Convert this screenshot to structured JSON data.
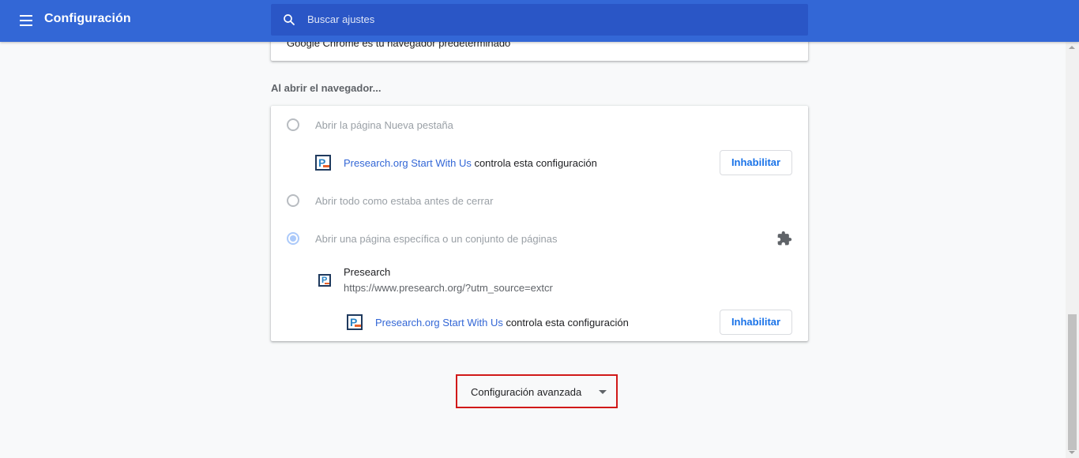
{
  "header": {
    "title": "Configuración",
    "search_placeholder": "Buscar ajustes"
  },
  "default_browser": {
    "text": "Google Chrome es tu navegador predeterminado"
  },
  "on_startup": {
    "section_title": "Al abrir el navegador...",
    "options": [
      {
        "label": "Abrir la página Nueva pestaña",
        "checked": false
      },
      {
        "label": "Abrir todo como estaba antes de cerrar",
        "checked": false
      },
      {
        "label": "Abrir una página específica o un conjunto de páginas",
        "checked": true
      }
    ],
    "extension_notice_1": {
      "extension_name": "Presearch.org Start With Us",
      "suffix": " controla esta configuración",
      "button": "Inhabilitar"
    },
    "startup_page": {
      "name": "Presearch",
      "url": "https://www.presearch.org/?utm_source=extcr"
    },
    "extension_notice_2": {
      "extension_name": "Presearch.org Start With Us",
      "suffix": " controla esta configuración",
      "button": "Inhabilitar"
    }
  },
  "advanced": {
    "label": "Configuración avanzada"
  },
  "icons": {
    "menu": "menu-icon",
    "search": "search-icon",
    "extension": "presearch-extension-icon",
    "puzzle": "puzzle-piece-icon",
    "dropdown": "chevron-down-icon"
  },
  "colors": {
    "header_bg": "#3367d6",
    "search_bg": "#2a56c6",
    "link": "#3367d6",
    "button_text": "#1a73e8",
    "highlight_border": "#d11919"
  }
}
